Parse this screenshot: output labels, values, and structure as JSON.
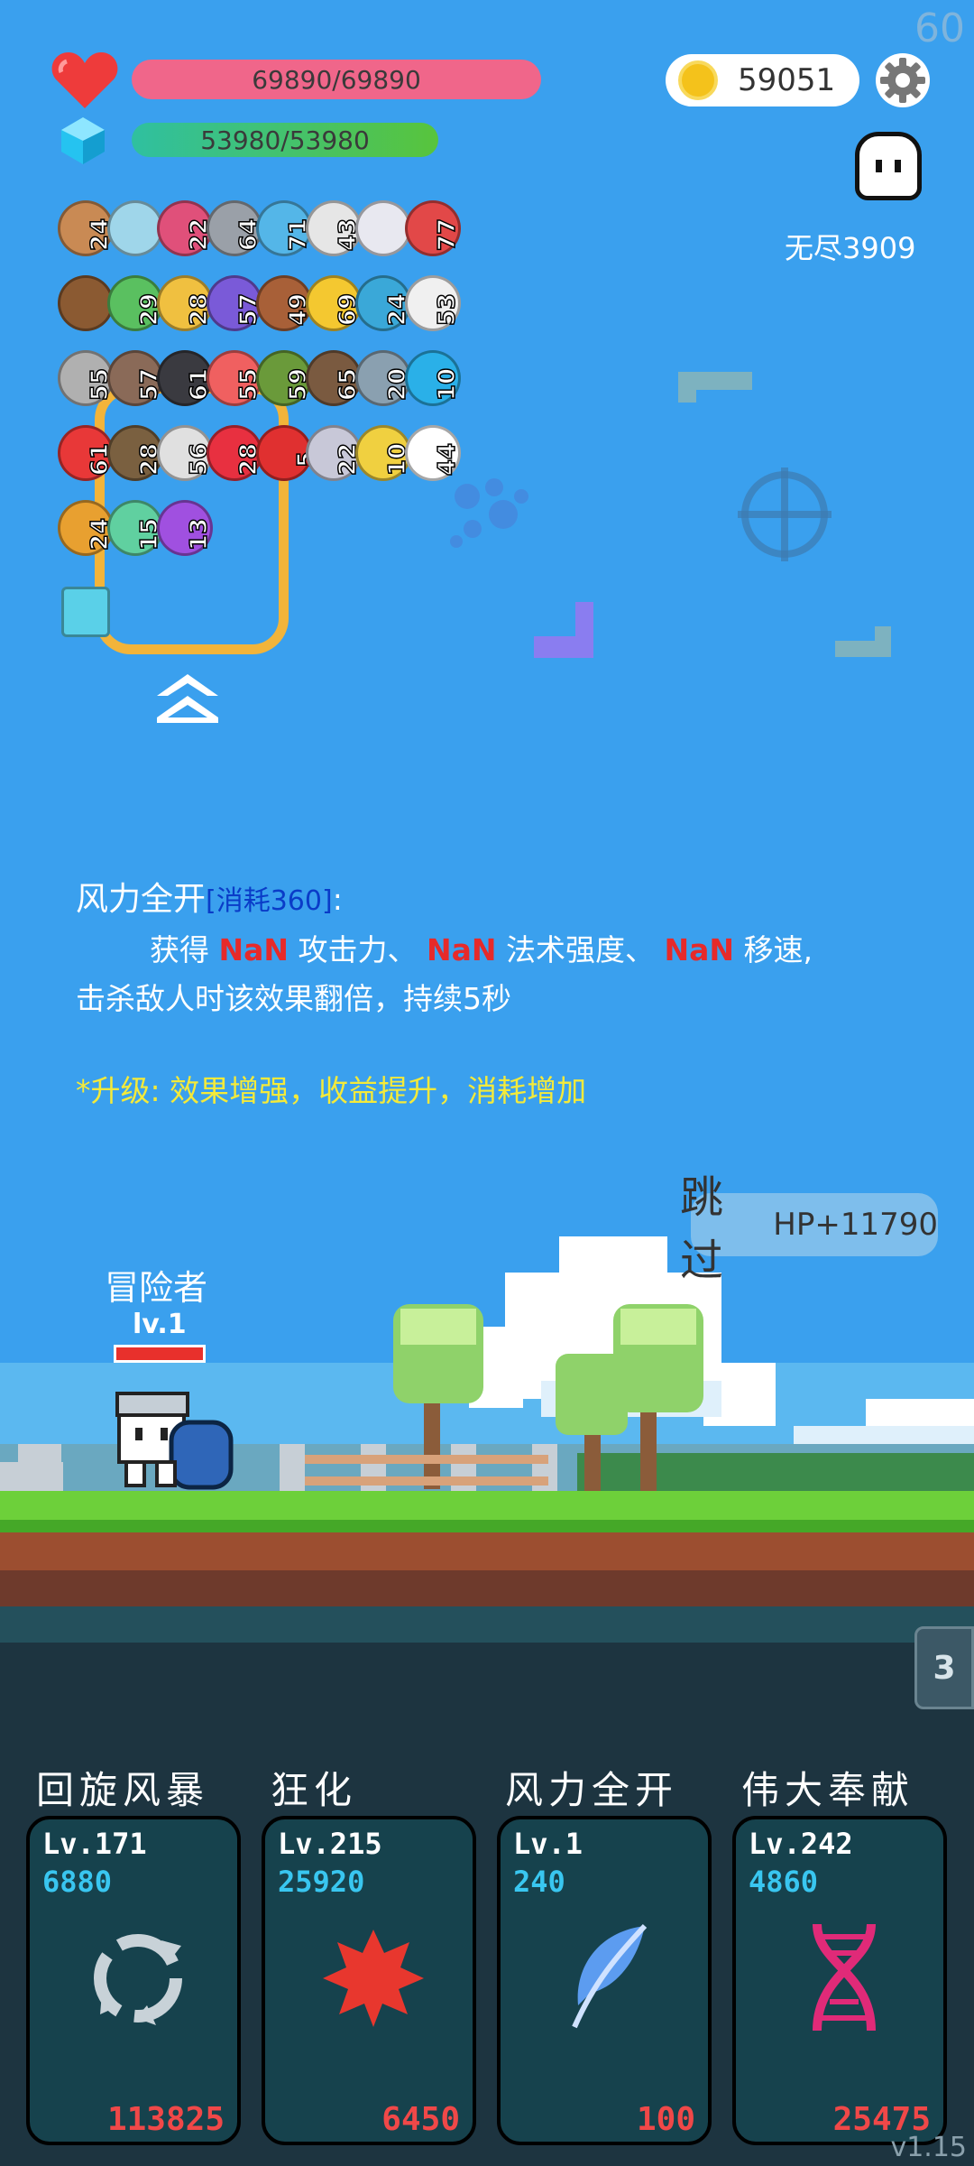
{
  "fps": "60",
  "player": {
    "hp_text": "69890/69890",
    "hp_fraction": 1.0,
    "mp_text": "53980/53980",
    "mp_fraction": 1.0
  },
  "currency": {
    "coins": "59051"
  },
  "mode": {
    "endless": "无尽3909"
  },
  "items": [
    {
      "icon": "cookie-icon",
      "count": "24"
    },
    {
      "icon": "magnifier-icon",
      "count": ""
    },
    {
      "icon": "jar-icon",
      "count": "22"
    },
    {
      "icon": "spiked-mace-icon",
      "count": "64"
    },
    {
      "icon": "blue-orb-icon",
      "count": "71"
    },
    {
      "icon": "stopwatch-icon",
      "count": "43"
    },
    {
      "icon": "crosshair-badge-icon",
      "count": ""
    },
    {
      "icon": "shield-icon",
      "count": "77"
    },
    {
      "icon": "treasure-chest-icon",
      "count": ""
    },
    {
      "icon": "watermelon-icon",
      "count": "29"
    },
    {
      "icon": "ring-icon",
      "count": "28"
    },
    {
      "icon": "purple-box-icon",
      "count": "57"
    },
    {
      "icon": "potion-icon",
      "count": "49"
    },
    {
      "icon": "sunflower-icon",
      "count": "69"
    },
    {
      "icon": "bird-icon",
      "count": "24"
    },
    {
      "icon": "envelope-icon",
      "count": "53"
    },
    {
      "icon": "axe-icon",
      "count": "55"
    },
    {
      "icon": "tombstone-icon",
      "count": "57"
    },
    {
      "icon": "bomb-icon",
      "count": "61"
    },
    {
      "icon": "pill-icon",
      "count": "55"
    },
    {
      "icon": "bow-icon",
      "count": "59"
    },
    {
      "icon": "coconut-icon",
      "count": "65"
    },
    {
      "icon": "sword-icon",
      "count": "20"
    },
    {
      "icon": "hexagon-gem-icon",
      "count": "10"
    },
    {
      "icon": "strawberry-icon",
      "count": "61"
    },
    {
      "icon": "rifle-icon",
      "count": "28"
    },
    {
      "icon": "dice-icon",
      "count": "56"
    },
    {
      "icon": "red-ball-icon",
      "count": "28"
    },
    {
      "icon": "heart-icon",
      "count": "5"
    },
    {
      "icon": "hook-icon",
      "count": "22"
    },
    {
      "icon": "magic-wand-icon",
      "count": "10"
    },
    {
      "icon": "ghost-icon",
      "count": "44"
    },
    {
      "icon": "book-icon",
      "count": "24"
    },
    {
      "icon": "green-key-icon",
      "count": "15"
    },
    {
      "icon": "crystal-ball-icon",
      "count": "13"
    },
    {
      "icon": "lightbulb-card-icon",
      "count": ""
    }
  ],
  "skill_desc": {
    "title": "风力全开",
    "cost_label": "[消耗360]",
    "colon": ":",
    "line1_prefix": "获得 ",
    "v1": "NaN",
    "t1": " 攻击力、 ",
    "v2": "NaN",
    "t2": " 法术强度、 ",
    "v3": "NaN",
    "t3": " 移速,",
    "line2": "击杀敌人时该效果翻倍，持续5秒",
    "upgrade": "*升级: 效果增强，收益提升，消耗增加"
  },
  "skip": {
    "label": "跳过",
    "hp_bonus": "HP+11790"
  },
  "hero": {
    "name": "冒险者",
    "level": "lv.1"
  },
  "side_badge": "3",
  "skills": [
    {
      "name": "回旋风暴",
      "level": "Lv.171",
      "cost": "6880",
      "count": "113825",
      "icon": "cycle-arrows-icon"
    },
    {
      "name": "狂化",
      "level": "Lv.215",
      "cost": "25920",
      "count": "6450",
      "icon": "red-splat-icon"
    },
    {
      "name": "风力全开",
      "level": "Lv.1",
      "cost": "240",
      "count": "100",
      "icon": "feather-icon"
    },
    {
      "name": "伟大奉献",
      "level": "Lv.242",
      "cost": "4860",
      "count": "25475",
      "icon": "dna-icon"
    }
  ],
  "version": "v1.15",
  "colors": {
    "hp_bar": "#f0668a",
    "mp_bar": "#4bbf4f",
    "accent_red": "#e62a2a",
    "upgrade_yellow": "#f4ea3a"
  }
}
